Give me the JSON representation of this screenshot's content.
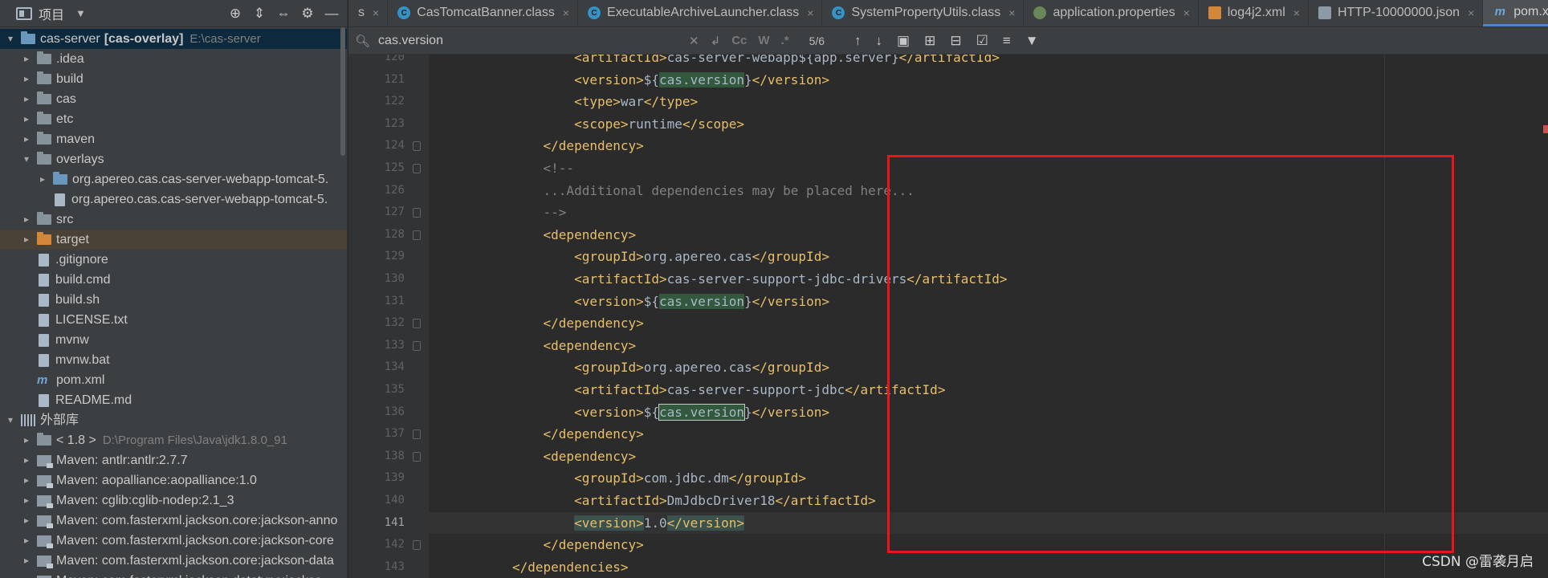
{
  "project_panel": {
    "title": "项目",
    "tree": [
      {
        "indent": 0,
        "arrow": "▾",
        "icon": "module",
        "name": "cas-server",
        "bold": "[cas-overlay]",
        "path": "E:\\cas-server",
        "state": "selected"
      },
      {
        "indent": 1,
        "arrow": "▸",
        "icon": "folder",
        "name": ".idea"
      },
      {
        "indent": 1,
        "arrow": "▸",
        "icon": "folder",
        "name": "build"
      },
      {
        "indent": 1,
        "arrow": "▸",
        "icon": "folder",
        "name": "cas"
      },
      {
        "indent": 1,
        "arrow": "▸",
        "icon": "folder",
        "name": "etc"
      },
      {
        "indent": 1,
        "arrow": "▸",
        "icon": "folder",
        "name": "maven"
      },
      {
        "indent": 1,
        "arrow": "▾",
        "icon": "folder",
        "name": "overlays"
      },
      {
        "indent": 2,
        "arrow": "▸",
        "icon": "module",
        "name": "org.apereo.cas.cas-server-webapp-tomcat-5."
      },
      {
        "indent": 2,
        "arrow": "",
        "icon": "file",
        "name": "org.apereo.cas.cas-server-webapp-tomcat-5."
      },
      {
        "indent": 1,
        "arrow": "▸",
        "icon": "folder",
        "name": "src"
      },
      {
        "indent": 1,
        "arrow": "▸",
        "icon": "folder-orange",
        "name": "target",
        "state": "target"
      },
      {
        "indent": 1,
        "arrow": "",
        "icon": "file",
        "name": ".gitignore"
      },
      {
        "indent": 1,
        "arrow": "",
        "icon": "file",
        "name": "build.cmd"
      },
      {
        "indent": 1,
        "arrow": "",
        "icon": "file",
        "name": "build.sh"
      },
      {
        "indent": 1,
        "arrow": "",
        "icon": "file",
        "name": "LICENSE.txt"
      },
      {
        "indent": 1,
        "arrow": "",
        "icon": "file",
        "name": "mvnw"
      },
      {
        "indent": 1,
        "arrow": "",
        "icon": "file",
        "name": "mvnw.bat"
      },
      {
        "indent": 1,
        "arrow": "",
        "icon": "mvn",
        "name": "pom.xml"
      },
      {
        "indent": 1,
        "arrow": "",
        "icon": "file",
        "name": "README.md"
      },
      {
        "indent": 0,
        "arrow": "▾",
        "icon": "lib",
        "name": "外部库"
      },
      {
        "indent": 1,
        "arrow": "▸",
        "icon": "folder",
        "name": "< 1.8 >",
        "path": "D:\\Program Files\\Java\\jdk1.8.0_91"
      },
      {
        "indent": 1,
        "arrow": "▸",
        "icon": "jar",
        "name": "Maven: antlr:antlr:2.7.7"
      },
      {
        "indent": 1,
        "arrow": "▸",
        "icon": "jar",
        "name": "Maven: aopalliance:aopalliance:1.0"
      },
      {
        "indent": 1,
        "arrow": "▸",
        "icon": "jar",
        "name": "Maven: cglib:cglib-nodep:2.1_3"
      },
      {
        "indent": 1,
        "arrow": "▸",
        "icon": "jar",
        "name": "Maven: com.fasterxml.jackson.core:jackson-anno"
      },
      {
        "indent": 1,
        "arrow": "▸",
        "icon": "jar",
        "name": "Maven: com.fasterxml.jackson.core:jackson-core"
      },
      {
        "indent": 1,
        "arrow": "▸",
        "icon": "jar",
        "name": "Maven: com.fasterxml.jackson.core:jackson-data"
      },
      {
        "indent": 1,
        "arrow": "▸",
        "icon": "jar",
        "name": "Maven: com.fasterxml.jackson.datatype:jackso"
      }
    ]
  },
  "tabs": [
    {
      "label": "s",
      "icon": "",
      "close": "×"
    },
    {
      "label": "CasTomcatBanner.class",
      "icon": "cls",
      "close": "×"
    },
    {
      "label": "ExecutableArchiveLauncher.class",
      "icon": "cls",
      "close": "×"
    },
    {
      "label": "SystemPropertyUtils.class",
      "icon": "cls",
      "close": "×"
    },
    {
      "label": "application.properties",
      "icon": "prop",
      "close": "×"
    },
    {
      "label": "log4j2.xml",
      "icon": "xml",
      "close": "×"
    },
    {
      "label": "HTTP-10000000.json",
      "icon": "json",
      "close": "×"
    },
    {
      "label": "pom.xml",
      "icon": "mvn",
      "close": "",
      "active": true
    }
  ],
  "find": {
    "value": "cas.version",
    "match_count": "5/6",
    "case_label": "Cc",
    "word_label": "W",
    "regex_label": ".*"
  },
  "code": {
    "current_line": "141",
    "lines": [
      {
        "n": "120",
        "fold": false,
        "parts": [
          [
            "x",
            "        "
          ],
          [
            "t",
            "<artifactId>"
          ],
          [
            "x",
            "cas-server-webapp${app.server}"
          ],
          [
            "t",
            "</artifactId>"
          ]
        ]
      },
      {
        "n": "121",
        "fold": false,
        "parts": [
          [
            "x",
            "        "
          ],
          [
            "t",
            "<version>"
          ],
          [
            "x",
            "${"
          ],
          [
            "hl",
            "cas.version"
          ],
          [
            "x",
            "}"
          ],
          [
            "t",
            "</version>"
          ]
        ]
      },
      {
        "n": "122",
        "fold": false,
        "parts": [
          [
            "x",
            "        "
          ],
          [
            "t",
            "<type>"
          ],
          [
            "x",
            "war"
          ],
          [
            "t",
            "</type>"
          ]
        ]
      },
      {
        "n": "123",
        "fold": false,
        "parts": [
          [
            "x",
            "        "
          ],
          [
            "t",
            "<scope>"
          ],
          [
            "x",
            "runtime"
          ],
          [
            "t",
            "</scope>"
          ]
        ]
      },
      {
        "n": "124",
        "fold": true,
        "parts": [
          [
            "x",
            "    "
          ],
          [
            "t",
            "</dependency>"
          ]
        ]
      },
      {
        "n": "125",
        "fold": true,
        "parts": [
          [
            "x",
            "    "
          ],
          [
            "c",
            "<!--"
          ]
        ]
      },
      {
        "n": "126",
        "fold": false,
        "parts": [
          [
            "x",
            "    "
          ],
          [
            "c",
            "...Additional dependencies may be placed here..."
          ]
        ]
      },
      {
        "n": "127",
        "fold": true,
        "parts": [
          [
            "x",
            "    "
          ],
          [
            "c",
            "-->"
          ]
        ]
      },
      {
        "n": "128",
        "fold": true,
        "parts": [
          [
            "x",
            "    "
          ],
          [
            "t",
            "<dependency>"
          ]
        ]
      },
      {
        "n": "129",
        "fold": false,
        "parts": [
          [
            "x",
            "        "
          ],
          [
            "t",
            "<groupId>"
          ],
          [
            "x",
            "org.apereo.cas"
          ],
          [
            "t",
            "</groupId>"
          ]
        ]
      },
      {
        "n": "130",
        "fold": false,
        "parts": [
          [
            "x",
            "        "
          ],
          [
            "t",
            "<artifactId>"
          ],
          [
            "x",
            "cas-server-support-jdbc-drivers"
          ],
          [
            "t",
            "</artifactId>"
          ]
        ]
      },
      {
        "n": "131",
        "fold": false,
        "parts": [
          [
            "x",
            "        "
          ],
          [
            "t",
            "<version>"
          ],
          [
            "x",
            "${"
          ],
          [
            "hl",
            "cas.version"
          ],
          [
            "x",
            "}"
          ],
          [
            "t",
            "</version>"
          ]
        ]
      },
      {
        "n": "132",
        "fold": true,
        "parts": [
          [
            "x",
            "    "
          ],
          [
            "t",
            "</dependency>"
          ]
        ]
      },
      {
        "n": "133",
        "fold": true,
        "parts": [
          [
            "x",
            "    "
          ],
          [
            "t",
            "<dependency>"
          ]
        ]
      },
      {
        "n": "134",
        "fold": false,
        "parts": [
          [
            "x",
            "        "
          ],
          [
            "t",
            "<groupId>"
          ],
          [
            "x",
            "org.apereo.cas"
          ],
          [
            "t",
            "</groupId>"
          ]
        ]
      },
      {
        "n": "135",
        "fold": false,
        "parts": [
          [
            "x",
            "        "
          ],
          [
            "t",
            "<artifactId>"
          ],
          [
            "x",
            "cas-server-support-jdbc"
          ],
          [
            "t",
            "</artifactId>"
          ]
        ]
      },
      {
        "n": "136",
        "fold": false,
        "parts": [
          [
            "x",
            "        "
          ],
          [
            "t",
            "<version>"
          ],
          [
            "x",
            "${"
          ],
          [
            "hlsel",
            "cas.version"
          ],
          [
            "x",
            "}"
          ],
          [
            "t",
            "</version>"
          ]
        ]
      },
      {
        "n": "137",
        "fold": true,
        "parts": [
          [
            "x",
            "    "
          ],
          [
            "t",
            "</dependency>"
          ]
        ]
      },
      {
        "n": "138",
        "fold": true,
        "parts": [
          [
            "x",
            "    "
          ],
          [
            "t",
            "<dependency>"
          ]
        ]
      },
      {
        "n": "139",
        "fold": false,
        "parts": [
          [
            "x",
            "        "
          ],
          [
            "t",
            "<groupId>"
          ],
          [
            "x",
            "com.jdbc.dm"
          ],
          [
            "t",
            "</groupId>"
          ]
        ]
      },
      {
        "n": "140",
        "fold": false,
        "parts": [
          [
            "x",
            "        "
          ],
          [
            "t",
            "<artifactId>"
          ],
          [
            "x",
            "DmJdbcDriver18"
          ],
          [
            "t",
            "</artifactId>"
          ]
        ]
      },
      {
        "n": "141",
        "fold": false,
        "parts": [
          [
            "x",
            "        "
          ],
          [
            "tagHl",
            "<version>"
          ],
          [
            "x",
            "1.0"
          ],
          [
            "tagHl",
            "</version>"
          ]
        ]
      },
      {
        "n": "142",
        "fold": true,
        "parts": [
          [
            "x",
            "    "
          ],
          [
            "t",
            "</dependency>"
          ]
        ]
      },
      {
        "n": "143",
        "fold": false,
        "parts": [
          [
            "t",
            "</dependencies>"
          ]
        ]
      }
    ]
  },
  "watermark": "CSDN @雷袭月启",
  "colors": {
    "annotation_box": "#e8161b",
    "search_highlight": "#32593d",
    "tag": "#e8bf6a",
    "comment": "#808080"
  }
}
